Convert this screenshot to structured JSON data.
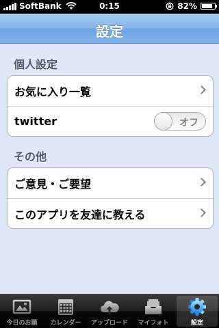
{
  "status_bar": {
    "carrier": "SoftBank",
    "time": "0:15",
    "battery": "82%",
    "battery_level": 0.82
  },
  "nav": {
    "title": "設定"
  },
  "sections": [
    {
      "header": "個人設定",
      "rows": [
        {
          "label": "お気に入り一覧"
        },
        {
          "label": "twitter",
          "switch_label": "オフ",
          "switch_on": false
        }
      ]
    },
    {
      "header": "その他",
      "rows": [
        {
          "label": "ご意見・ご要望"
        },
        {
          "label": "このアプリを友達に教える"
        }
      ]
    }
  ],
  "tabs": [
    {
      "label": "今日のお題",
      "icon": "photo-icon"
    },
    {
      "label": "カレンダー",
      "icon": "calendar-icon"
    },
    {
      "label": "アップロード",
      "icon": "cloud-upload-icon"
    },
    {
      "label": "マイフォト",
      "icon": "tray-icon"
    },
    {
      "label": "設定",
      "icon": "gear-icon",
      "active": true
    }
  ]
}
